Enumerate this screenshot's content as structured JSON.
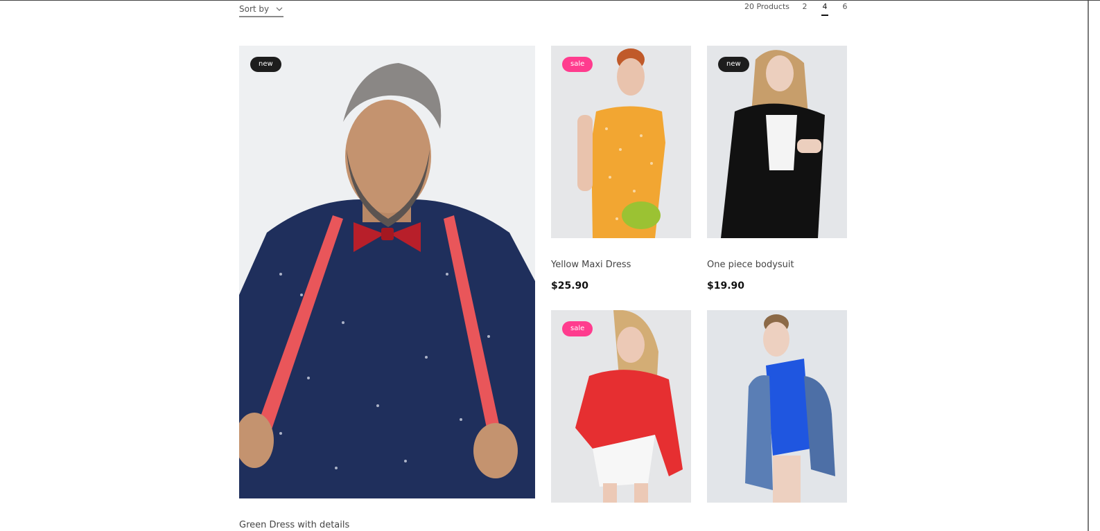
{
  "toolbar": {
    "sort_label": "Sort by",
    "product_count": "20 Products",
    "column_options": [
      "2",
      "4",
      "6"
    ],
    "active_columns": "4"
  },
  "products": [
    {
      "badge": "new",
      "name": "Green Dress with details",
      "price": ""
    },
    {
      "badge": "sale",
      "name": "Yellow Maxi Dress",
      "price": "$25.90"
    },
    {
      "badge": "new",
      "name": "One piece bodysuit",
      "price": "$19.90"
    },
    {
      "badge": "sale",
      "name": "",
      "price": ""
    },
    {
      "badge": "",
      "name": "",
      "price": ""
    }
  ],
  "colors": {
    "new_badge": "#1d1d1d",
    "sale_badge": "#ff3c8e",
    "accent_text": "#111111"
  }
}
